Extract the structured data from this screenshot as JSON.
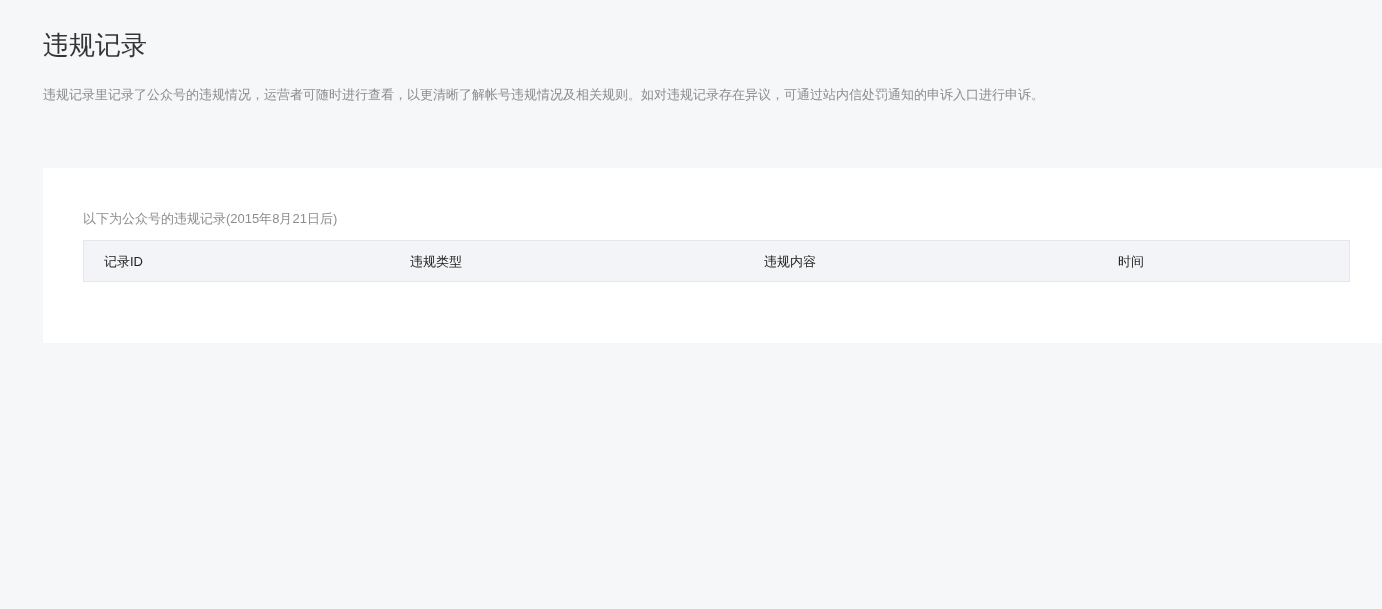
{
  "page": {
    "title": "违规记录",
    "description": "违规记录里记录了公众号的违规情况，运营者可随时进行查看，以更清晰了解帐号违规情况及相关规则。如对违规记录存在异议，可通过站内信处罚通知的申诉入口进行申诉。"
  },
  "records": {
    "caption": "以下为公众号的违规记录(2015年8月21日后)",
    "columns": [
      "记录ID",
      "违规类型",
      "违规内容",
      "时间"
    ]
  }
}
